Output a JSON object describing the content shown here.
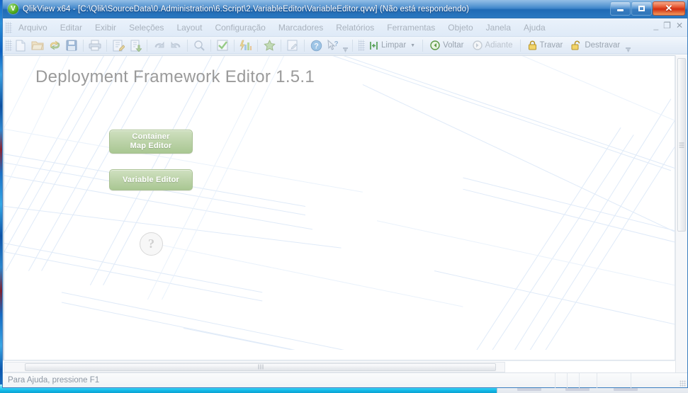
{
  "window": {
    "title": "QlikView x64 - [C:\\Qlik\\SourceData\\0.Administration\\6.Script\\2.VariableEditor\\VariableEditor.qvw] (Não está respondendo)",
    "logo_label": "V",
    "controls": {
      "minimize": "minimize-icon",
      "maximize": "maximize-icon",
      "close": "✕"
    }
  },
  "menubar": {
    "items": [
      {
        "label": "Arquivo"
      },
      {
        "label": "Editar"
      },
      {
        "label": "Exibir"
      },
      {
        "label": "Seleções"
      },
      {
        "label": "Layout"
      },
      {
        "label": "Configuração"
      },
      {
        "label": "Marcadores"
      },
      {
        "label": "Relatórios"
      },
      {
        "label": "Ferramentas"
      },
      {
        "label": "Objeto"
      },
      {
        "label": "Janela"
      },
      {
        "label": "Ajuda"
      }
    ],
    "mdi_controls": {
      "minimize": "_",
      "restore": "❐",
      "close": "✕"
    }
  },
  "toolbar": {
    "icons": [
      {
        "name": "new-document-icon"
      },
      {
        "name": "open-folder-icon"
      },
      {
        "name": "reload-icon"
      },
      {
        "name": "save-icon"
      },
      {
        "name": "print-icon"
      },
      {
        "name": "edit-script-icon"
      },
      {
        "name": "export-document-icon"
      },
      {
        "name": "undo-icon"
      },
      {
        "name": "redo-icon"
      },
      {
        "name": "search-icon"
      },
      {
        "name": "current-selections-icon"
      },
      {
        "name": "chart-icon"
      },
      {
        "name": "bookmark-star-icon"
      },
      {
        "name": "edit-expression-icon"
      },
      {
        "name": "help-icon"
      },
      {
        "name": "context-help-icon"
      }
    ],
    "commands": [
      {
        "label": "Limpar",
        "icon": "clear-selections-icon",
        "has_caret": true,
        "disabled": false
      },
      {
        "label": "Voltar",
        "icon": "back-arrow-icon",
        "has_caret": false,
        "disabled": false
      },
      {
        "label": "Adiante",
        "icon": "forward-arrow-icon",
        "has_caret": false,
        "disabled": true
      },
      {
        "label": "Travar",
        "icon": "lock-icon",
        "has_caret": false,
        "disabled": false
      },
      {
        "label": "Destravar",
        "icon": "unlock-icon",
        "has_caret": false,
        "disabled": false
      }
    ],
    "overflow_label": "▼"
  },
  "sheet": {
    "title": "Deployment Framework Editor 1.5.1",
    "buttons": [
      {
        "id": "container-map-editor",
        "line1": "Container",
        "line2": "Map Editor"
      },
      {
        "id": "variable-editor",
        "line1": "Variable Editor",
        "line2": ""
      }
    ],
    "help_button_label": "?",
    "accent_green": "#b6d0a2",
    "title_color": "#9a9a9a"
  },
  "statusbar": {
    "text": "Para Ajuda, pressione F1"
  }
}
